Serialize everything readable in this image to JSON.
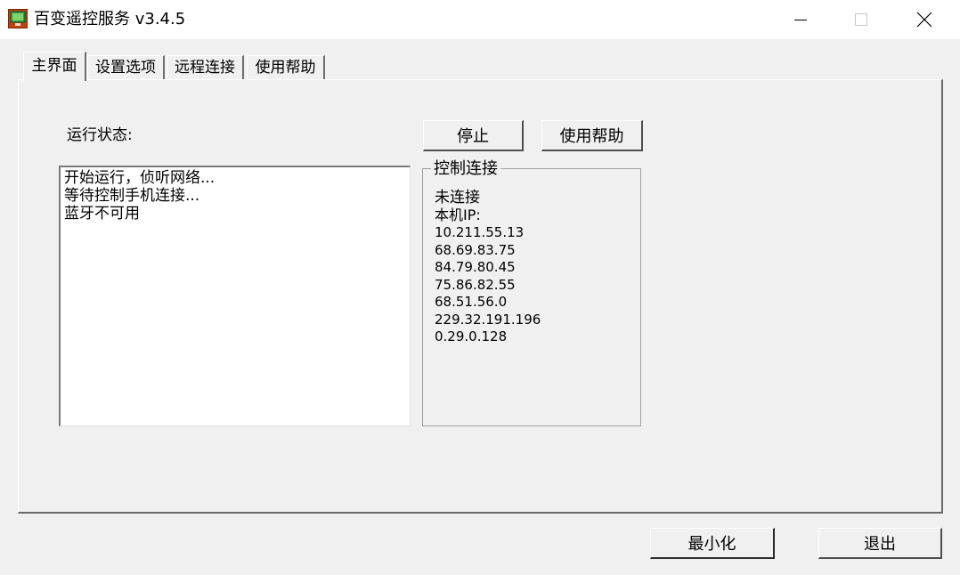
{
  "window": {
    "title": "百变遥控服务 v3.4.5",
    "icon": "app-monitor-icon",
    "controls": [
      "minimize-icon",
      "maximize-icon",
      "close-icon"
    ]
  },
  "tabs": [
    {
      "label": "主界面",
      "active": true
    },
    {
      "label": "设置选项",
      "active": false
    },
    {
      "label": "远程连接",
      "active": false
    },
    {
      "label": "使用帮助",
      "active": false
    }
  ],
  "main": {
    "status_label": "运行状态:",
    "log_lines": [
      "开始运行，侦听网络...",
      "等待控制手机连接...",
      "蓝牙不可用"
    ],
    "stop_button": "停止",
    "help_button": "使用帮助",
    "connection": {
      "group_title": "控制连接",
      "status": "未连接",
      "local_ip_label": "本机IP:",
      "ips": [
        "10.211.55.13",
        "68.69.83.75",
        "84.79.80.45",
        "75.86.82.55",
        "68.51.56.0",
        "229.32.191.196",
        "0.29.0.128"
      ]
    }
  },
  "footer": {
    "minimize_button": "最小化",
    "exit_button": "退出"
  },
  "colors": {
    "background": "#f0f0f0",
    "titlebar": "#ffffff",
    "log_background": "#ffffff"
  }
}
